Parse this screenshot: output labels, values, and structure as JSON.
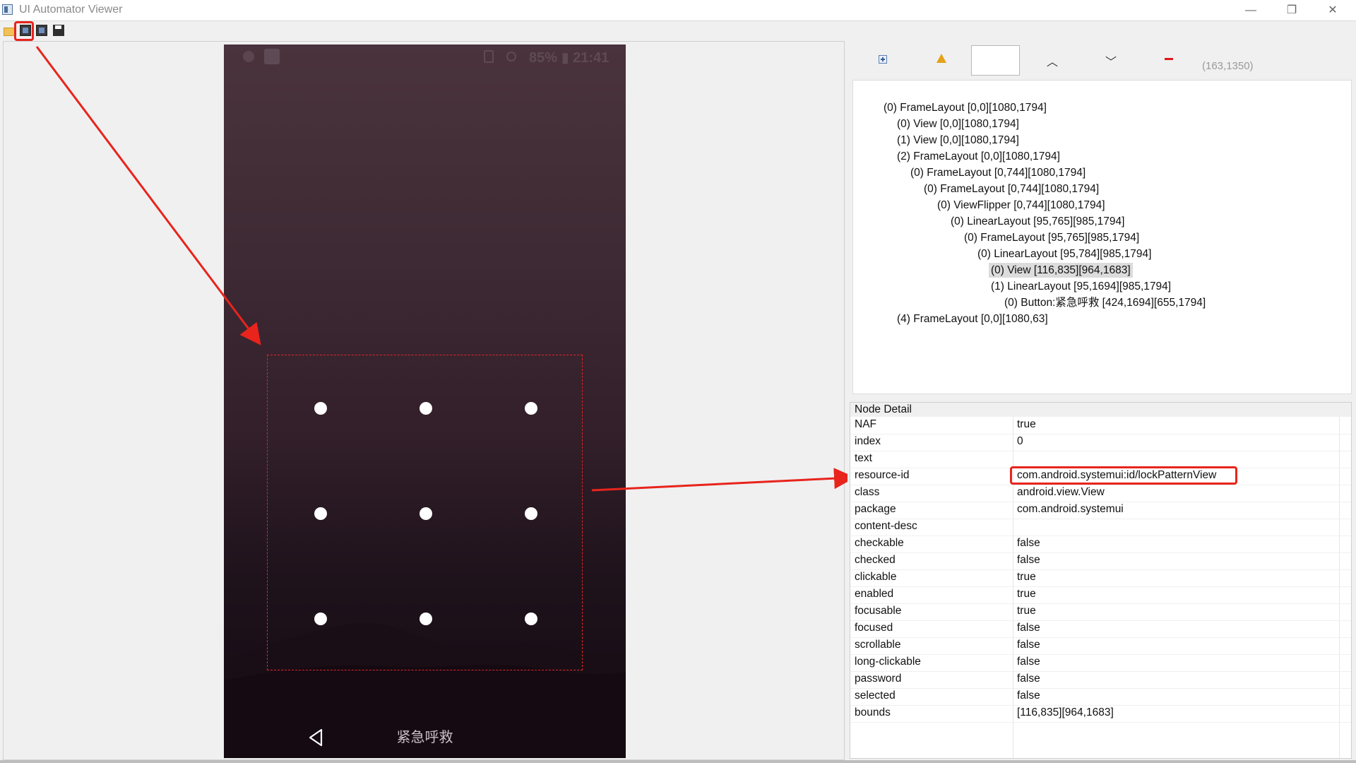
{
  "window": {
    "title": "UI Automator Viewer",
    "minimize": "—",
    "restore": "❐",
    "close": "✕"
  },
  "toolbar": {
    "items": [
      "open-icon",
      "device-screenshot-icon",
      "device-screenshot-compressed-icon",
      "save-icon"
    ]
  },
  "device": {
    "status_text": "85% ▮ 21:41",
    "emergency_label": "紧急呼救",
    "pattern_dots": 9
  },
  "tree_toolbar": {
    "coords": "(163,1350)"
  },
  "tree": {
    "nodes": [
      {
        "label": "(0) FrameLayout [0,0][1080,1794]",
        "depth": 0
      },
      {
        "label": "(0) View [0,0][1080,1794]",
        "depth": 1
      },
      {
        "label": "(1) View [0,0][1080,1794]",
        "depth": 1
      },
      {
        "label": "(2) FrameLayout [0,0][1080,1794]",
        "depth": 1
      },
      {
        "label": "(0) FrameLayout [0,744][1080,1794]",
        "depth": 2
      },
      {
        "label": "(0) FrameLayout [0,744][1080,1794]",
        "depth": 3
      },
      {
        "label": "(0) ViewFlipper [0,744][1080,1794]",
        "depth": 4
      },
      {
        "label": "(0) LinearLayout [95,765][985,1794]",
        "depth": 5
      },
      {
        "label": "(0) FrameLayout [95,765][985,1794]",
        "depth": 6
      },
      {
        "label": "(0) LinearLayout [95,784][985,1794]",
        "depth": 7
      },
      {
        "label": "(0) View [116,835][964,1683]",
        "depth": 8,
        "selected": true
      },
      {
        "label": "(1) LinearLayout [95,1694][985,1794]",
        "depth": 8
      },
      {
        "label": "(0) Button:紧急呼救 [424,1694][655,1794]",
        "depth": 9
      },
      {
        "label": "(4) FrameLayout [0,0][1080,63]",
        "depth": 1
      }
    ]
  },
  "node_detail": {
    "header": "Node Detail",
    "rows": [
      {
        "key": "NAF",
        "value": "true"
      },
      {
        "key": "index",
        "value": "0"
      },
      {
        "key": "text",
        "value": ""
      },
      {
        "key": "resource-id",
        "value": "com.android.systemui:id/lockPatternView"
      },
      {
        "key": "class",
        "value": "android.view.View"
      },
      {
        "key": "package",
        "value": "com.android.systemui"
      },
      {
        "key": "content-desc",
        "value": ""
      },
      {
        "key": "checkable",
        "value": "false"
      },
      {
        "key": "checked",
        "value": "false"
      },
      {
        "key": "clickable",
        "value": "true"
      },
      {
        "key": "enabled",
        "value": "true"
      },
      {
        "key": "focusable",
        "value": "true"
      },
      {
        "key": "focused",
        "value": "false"
      },
      {
        "key": "scrollable",
        "value": "false"
      },
      {
        "key": "long-clickable",
        "value": "false"
      },
      {
        "key": "password",
        "value": "false"
      },
      {
        "key": "selected",
        "value": "false"
      },
      {
        "key": "bounds",
        "value": "[116,835][964,1683]"
      }
    ]
  },
  "colors": {
    "annotation": "#e8241c",
    "selection": "#dcdcdc"
  }
}
